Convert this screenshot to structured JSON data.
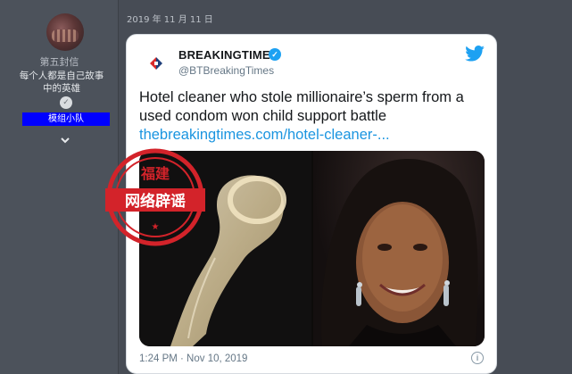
{
  "user": {
    "username": "第五封信",
    "signature": "每个人都是自己故事中的英雄",
    "group_badge": "模组小队",
    "icons": {
      "rank": "rank-badge-icon",
      "expand": "chevron-down-icon"
    }
  },
  "post": {
    "date": "2019 年 11 月 11 日"
  },
  "tweet": {
    "account_name": "BREAKINGTIMES",
    "handle": "@BTBreakingTimes",
    "text": "Hotel cleaner who stole millionaire’s sperm from a used condom won child support battle",
    "link": "thebreakingtimes.com/hotel-cleaner-...",
    "timestamp": "1:24 PM · Nov 10, 2019",
    "colors": {
      "link": "#1b95e0",
      "verified": "#1da1f2",
      "text": "#14171a",
      "muted": "#657786"
    }
  },
  "stamp": {
    "top_text": "福建",
    "band_text": "网络辟谣",
    "color": "#d3232a"
  }
}
